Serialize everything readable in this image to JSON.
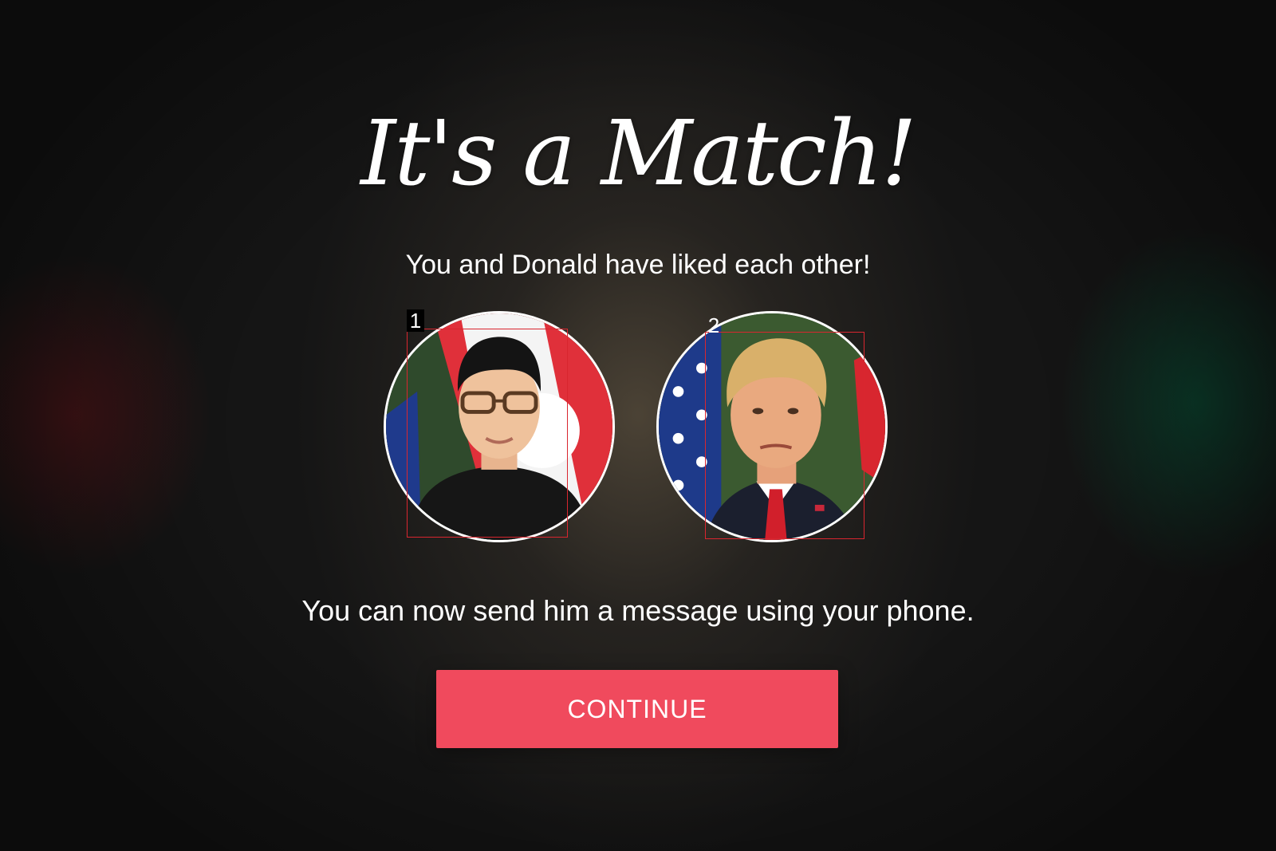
{
  "title": "It's a Match!",
  "subtitle": "You and Donald have liked each other!",
  "avatars": [
    {
      "marker": "1"
    },
    {
      "marker": "2"
    }
  ],
  "message": "You can now send him a message using your phone.",
  "continue_button": {
    "label": "CONTINUE"
  },
  "colors": {
    "button": "#f04a5d",
    "background": "#151515",
    "text": "#ffffff"
  }
}
